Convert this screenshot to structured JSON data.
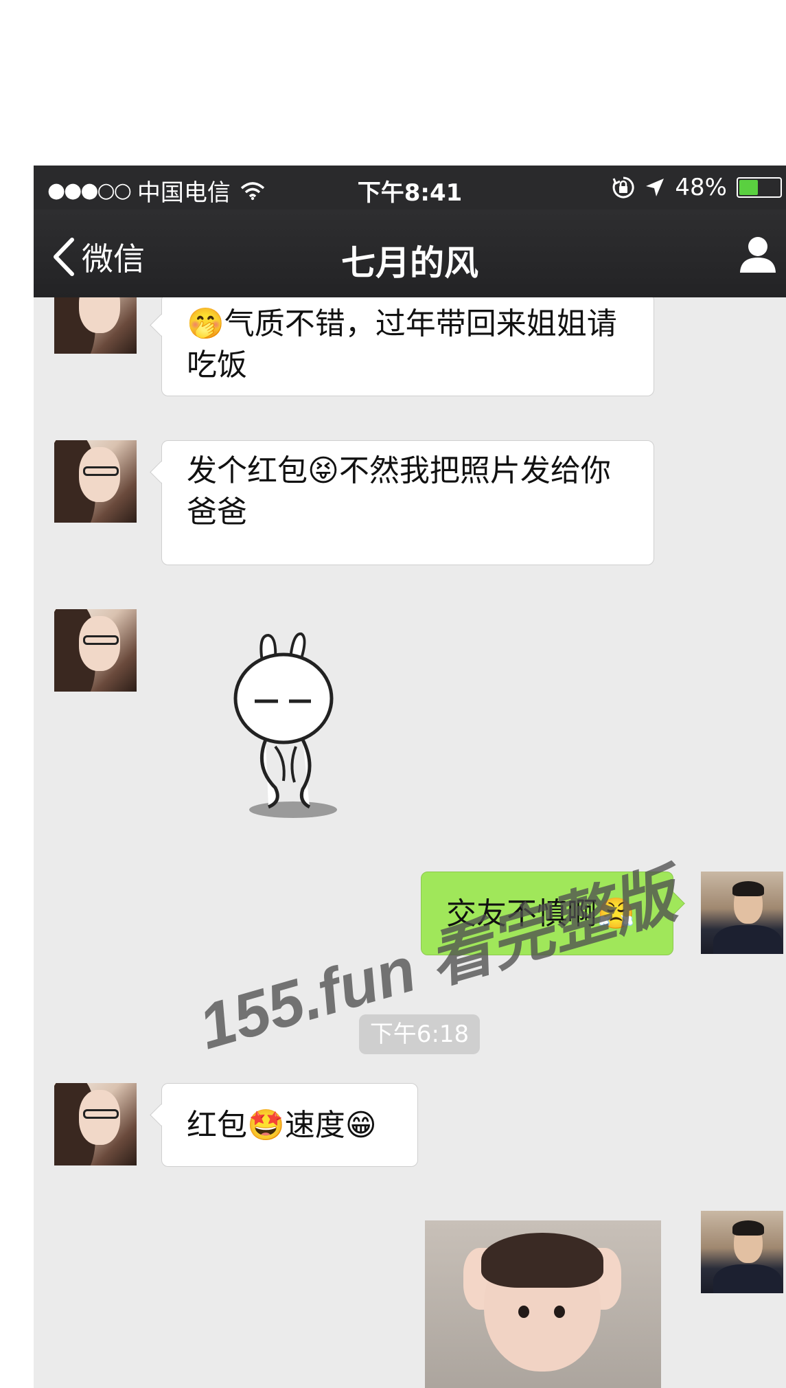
{
  "status_bar": {
    "signal": "●●●○○",
    "carrier": "中国电信",
    "time": "下午8:41",
    "battery_percent": "48%",
    "battery_level": 0.48
  },
  "nav": {
    "back_label": "微信",
    "title": "七月的风"
  },
  "messages": [
    {
      "side": "left",
      "text": "🤭气质不错，过年带回来姐姐请吃饭"
    },
    {
      "side": "left",
      "text": "发个红包😝不然我把照片发给你爸爸"
    },
    {
      "side": "left",
      "type": "sticker",
      "sticker": "rabbit-sticker"
    },
    {
      "side": "right",
      "text": "交友不慎啊😤"
    },
    {
      "side": "left",
      "text": "红包🤩速度😁"
    },
    {
      "side": "right",
      "type": "image",
      "image": "baby-photo"
    }
  ],
  "time_separator": "下午6:18",
  "watermark": "155.fun 看完整版",
  "colors": {
    "bar_bg": "#2a2a2c",
    "chat_bg": "#ebebeb",
    "sent_bubble": "#a0e75a",
    "received_bubble": "#ffffff",
    "battery_fill": "#5ad040"
  }
}
